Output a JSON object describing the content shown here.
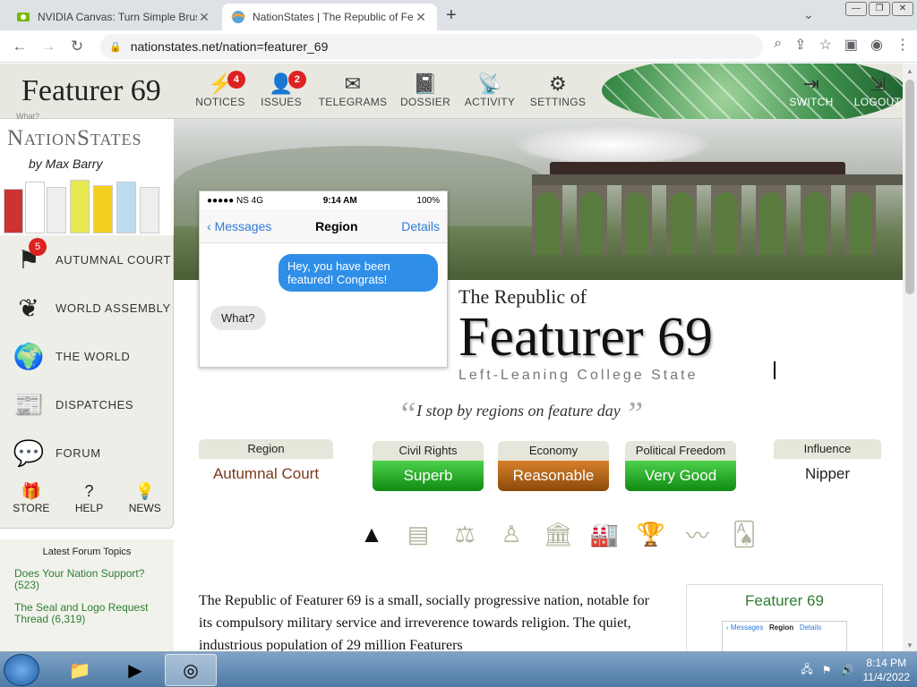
{
  "browser": {
    "tabs": [
      {
        "title": "NVIDIA Canvas: Turn Simple Brus",
        "active": false
      },
      {
        "title": "NationStates | The Republic of Fe",
        "active": true
      }
    ],
    "url": "nationstates.net/nation=featurer_69"
  },
  "header": {
    "nation_short": "Featurer 69",
    "nation_sub": "What?",
    "nav": [
      {
        "label": "NOTICES",
        "icon": "lightning-icon",
        "badge": "4"
      },
      {
        "label": "ISSUES",
        "icon": "person-icon",
        "badge": "2"
      },
      {
        "label": "TELEGRAMS",
        "icon": "envelope-icon",
        "badge": ""
      },
      {
        "label": "DOSSIER",
        "icon": "book-icon",
        "badge": ""
      },
      {
        "label": "ACTIVITY",
        "icon": "satellite-icon",
        "badge": ""
      },
      {
        "label": "SETTINGS",
        "icon": "gears-icon",
        "badge": ""
      }
    ],
    "right_nav": [
      {
        "label": "SWITCH",
        "icon": "switch-icon"
      },
      {
        "label": "LOGOUT",
        "icon": "logout-icon"
      }
    ]
  },
  "sidebar": {
    "logo": "NationStates",
    "byline": "by Max Barry",
    "menu": [
      {
        "label": "AUTUMNAL COURT",
        "icon": "flag-icon",
        "badge": "5"
      },
      {
        "label": "WORLD ASSEMBLY",
        "icon": "laurel-icon",
        "badge": ""
      },
      {
        "label": "THE WORLD",
        "icon": "globe-icon",
        "badge": ""
      },
      {
        "label": "DISPATCHES",
        "icon": "newspaper-icon",
        "badge": ""
      },
      {
        "label": "FORUM",
        "icon": "speech-bubbles-icon",
        "badge": ""
      }
    ],
    "bottom": [
      {
        "label": "STORE",
        "icon": "gift-icon"
      },
      {
        "label": "HELP",
        "icon": "question-icon"
      },
      {
        "label": "NEWS",
        "icon": "lightbulb-icon"
      }
    ],
    "forum_heading": "Latest Forum Topics",
    "forum_topics": [
      "Does Your Nation Support? (523)",
      "The Seal and Logo Request Thread (6,319)"
    ]
  },
  "phone": {
    "status_left": "●●●●● NS 4G",
    "status_time": "9:14 AM",
    "status_right": "100%",
    "back": "Messages",
    "title": "Region",
    "details": "Details",
    "msg_out": "Hey, you have been featured! Congrats!",
    "msg_in": "What?"
  },
  "nation": {
    "pretitle": "The Republic of",
    "name": "Featurer 69",
    "category": "Left-Leaning College State",
    "motto": "I stop by regions on feature day"
  },
  "stats": [
    {
      "label": "Region",
      "value": "Autumnal Court",
      "style": "plain"
    },
    {
      "label": "Civil Rights",
      "value": "Superb",
      "style": "green"
    },
    {
      "label": "Economy",
      "value": "Reasonable",
      "style": "orange"
    },
    {
      "label": "Political Freedom",
      "value": "Very Good",
      "style": "green"
    },
    {
      "label": "Influence",
      "value": "Nipper",
      "style": "black"
    }
  ],
  "category_icons": [
    "monument-icon",
    "newspaper-icon",
    "scales-icon",
    "person-icon",
    "government-building-icon",
    "factory-icon",
    "trophy-icon",
    "trend-line-icon",
    "cards-icon"
  ],
  "description": "The Republic of Featurer 69 is a small, socially progressive nation, notable for its compulsory military service and irreverence towards religion. The quiet, industrious population of 29 million Featurers",
  "flagbox": {
    "name": "Featurer 69",
    "mini_back": "Messages",
    "mini_title": "Region",
    "mini_details": "Details"
  },
  "taskbar": {
    "time": "8:14 PM",
    "date": "11/4/2022"
  }
}
